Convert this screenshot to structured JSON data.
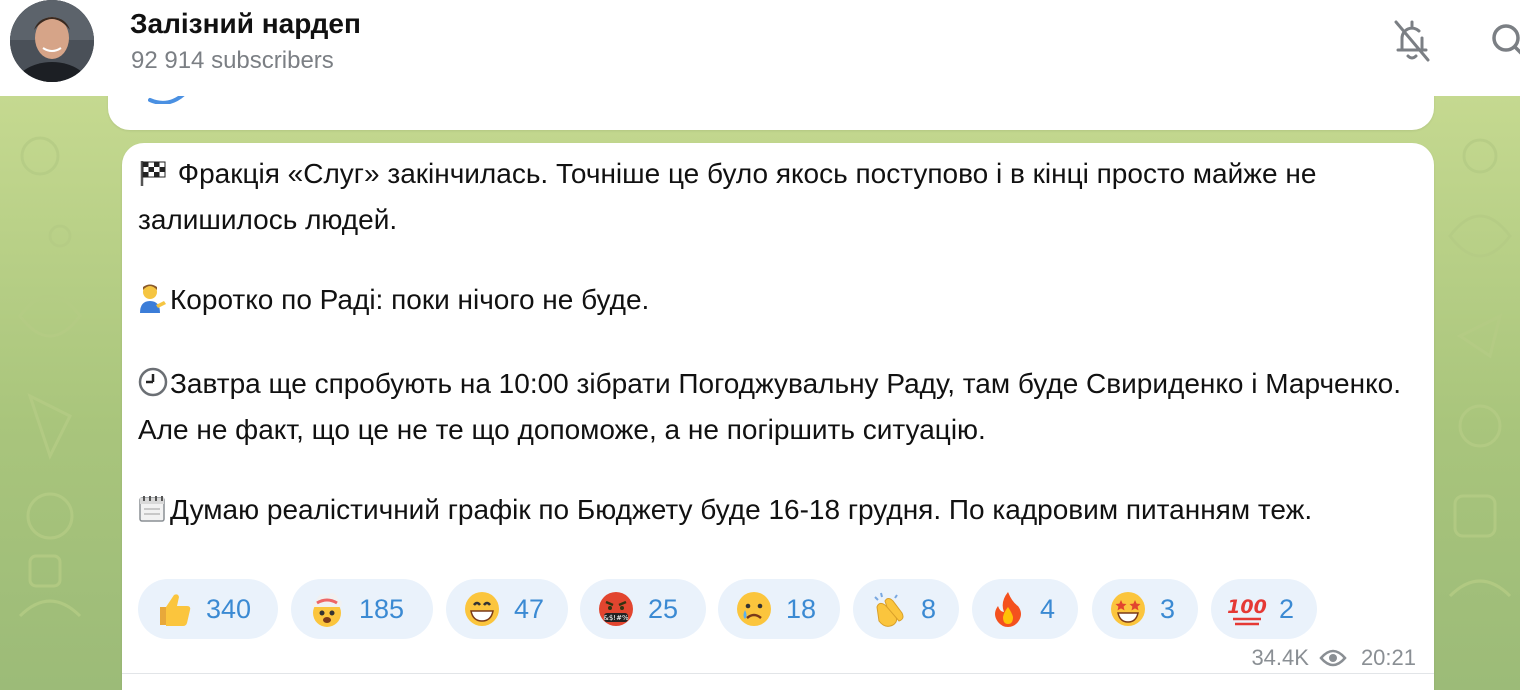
{
  "header": {
    "channel_name": "Залізний нардеп",
    "subscribers": "92 914 subscribers",
    "avatar_icon": "channel-avatar",
    "mute_icon": "bell-off-icon",
    "search_icon": "search-icon"
  },
  "message": {
    "paragraphs": [
      {
        "icon": "chequered-flag-icon",
        "text": " Фракція «Слуг» закінчилась. Точніше це було якось поступово і в кінці просто майже не залишилось людей."
      },
      {
        "icon": "person-tipping-hand-icon",
        "text": "Коротко по Раді: поки нічого не буде."
      },
      {
        "icon": "clock-icon",
        "text": "Завтра ще спробують на 10:00 зібрати Погоджувальну Раду, там буде Свириденко і Марченко. Але не факт, що це не те що допоможе, а не погіршить ситуацію."
      },
      {
        "icon": "spiral-calendar-icon",
        "text": "Думаю реалістичний графік по Бюджету буде 16-18 грудня. По кадровим питанням теж."
      }
    ],
    "reactions": [
      {
        "emoji": "thumbs-up",
        "count": "340"
      },
      {
        "emoji": "exploding-head",
        "count": "185"
      },
      {
        "emoji": "grinning-face",
        "count": "47"
      },
      {
        "emoji": "face-with-symbols",
        "count": "25"
      },
      {
        "emoji": "crying-face",
        "count": "18"
      },
      {
        "emoji": "clapping-hands",
        "count": "8"
      },
      {
        "emoji": "fire",
        "count": "4"
      },
      {
        "emoji": "star-struck",
        "count": "3"
      },
      {
        "emoji": "hundred-points",
        "count": "2"
      }
    ],
    "views": "34.4K",
    "time": "20:21",
    "views_icon": "eye-icon"
  },
  "colors": {
    "accent": "#3b8ad3",
    "reaction_bg": "#eaf2fb",
    "background": "#b9cf88"
  }
}
